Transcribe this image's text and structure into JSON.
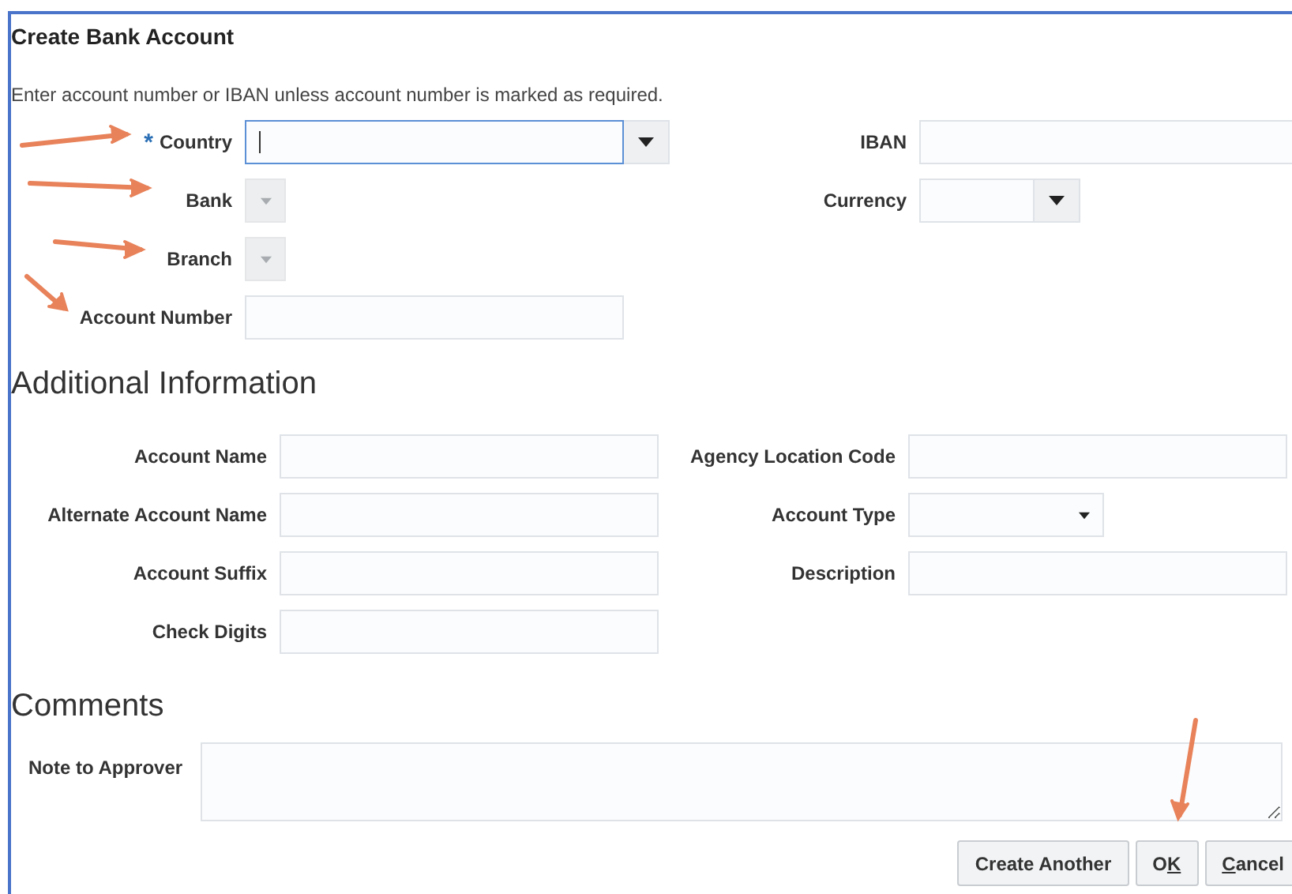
{
  "dialog": {
    "title": "Create Bank Account",
    "instructions": "Enter account number or IBAN unless account number is marked as required.",
    "fields_left": [
      {
        "label": "Country",
        "required_mark": "*",
        "kind": "combobox",
        "focused": true,
        "disabled": false
      },
      {
        "label": "Bank",
        "kind": "choice",
        "focused": false,
        "disabled": true
      },
      {
        "label": "Branch",
        "kind": "choice",
        "focused": false,
        "disabled": true
      },
      {
        "label": "Account Number",
        "kind": "text",
        "focused": false,
        "disabled": false
      }
    ],
    "fields_right": [
      {
        "label": "IBAN",
        "kind": "text",
        "focused": false,
        "disabled": false
      },
      {
        "label": "Currency",
        "kind": "combobox",
        "focused": false,
        "disabled": false
      }
    ]
  },
  "additional_information": {
    "heading": "Additional Information",
    "fields_left": [
      {
        "label": "Account Name",
        "kind": "text"
      },
      {
        "label": "Alternate Account Name",
        "kind": "text"
      },
      {
        "label": "Account Suffix",
        "kind": "text"
      },
      {
        "label": "Check Digits",
        "kind": "text"
      }
    ],
    "fields_right": [
      {
        "label": "Agency Location Code",
        "kind": "text"
      },
      {
        "label": "Account Type",
        "kind": "select"
      },
      {
        "label": "Description",
        "kind": "text"
      }
    ]
  },
  "comments": {
    "heading": "Comments",
    "fields": [
      {
        "label": "Note to Approver",
        "kind": "textarea"
      }
    ]
  },
  "buttons": [
    {
      "label": "Create Another"
    },
    {
      "label_parts": [
        {
          "text": "O",
          "underlined": false
        },
        {
          "text": "K",
          "underlined": true
        }
      ]
    },
    {
      "label_parts": [
        {
          "text": "C",
          "underlined": true
        },
        {
          "text": "ancel",
          "underlined": false
        }
      ]
    }
  ]
}
